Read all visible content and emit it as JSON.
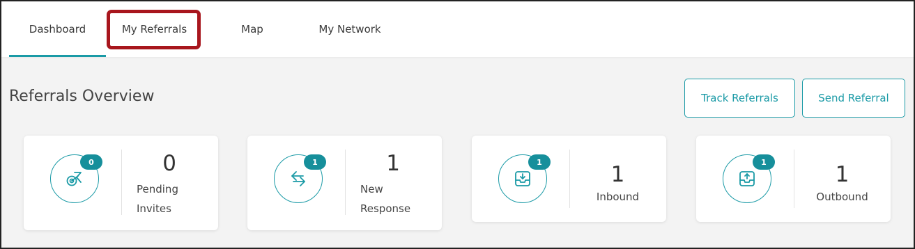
{
  "tabs": [
    {
      "label": "Dashboard",
      "active": true
    },
    {
      "label": "My Referrals",
      "active": false
    },
    {
      "label": "Map",
      "active": false
    },
    {
      "label": "My Network",
      "active": false
    }
  ],
  "section": {
    "title": "Referrals Overview",
    "track_button": "Track Referrals",
    "send_button": "Send Referral"
  },
  "cards": [
    {
      "badge": "0",
      "count": "0",
      "label_line1": "Pending",
      "label_line2": "Invites",
      "icon": "pending-invites-icon"
    },
    {
      "badge": "1",
      "count": "1",
      "label_line1": "New",
      "label_line2": "Response",
      "icon": "exchange-arrows-icon"
    },
    {
      "badge": "1",
      "count": "1",
      "label": "Inbound",
      "icon": "inbox-download-icon"
    },
    {
      "badge": "1",
      "count": "1",
      "label": "Outbound",
      "icon": "outbox-upload-icon"
    }
  ],
  "colors": {
    "accent": "#1a9aa6",
    "badge": "#168f9b",
    "highlight": "#a8161d",
    "background": "#f3f3f3"
  }
}
